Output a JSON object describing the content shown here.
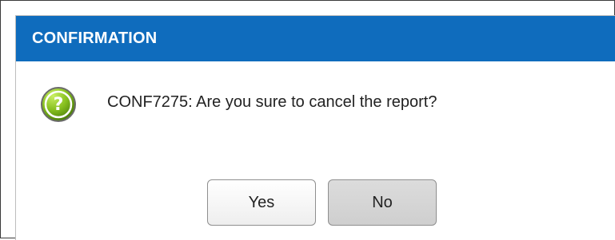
{
  "dialog": {
    "title": "CONFIRMATION",
    "message": "CONF7275: Are you sure to cancel the report?",
    "icon": "question-icon",
    "buttons": {
      "yes_label": "Yes",
      "no_label": "No"
    },
    "colors": {
      "titlebar": "#0f6cbd",
      "title_text": "#ffffff",
      "icon_green": "#8bbd22"
    }
  }
}
